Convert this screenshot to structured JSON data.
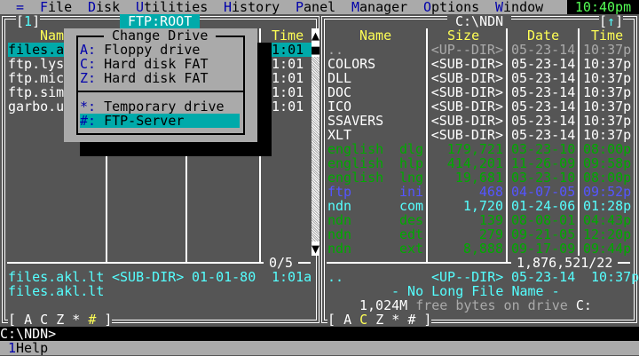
{
  "menu": {
    "items": [
      {
        "hot": "=",
        "rest": ""
      },
      {
        "hot": "F",
        "rest": "ile"
      },
      {
        "hot": "D",
        "rest": "isk"
      },
      {
        "hot": "U",
        "rest": "tilities"
      },
      {
        "hot": "H",
        "rest": "istory"
      },
      {
        "hot": "P",
        "rest": "anel"
      },
      {
        "hot": "M",
        "rest": "anager"
      },
      {
        "hot": "O",
        "rest": "ptions"
      },
      {
        "hot": "W",
        "rest": "indow"
      }
    ],
    "clock": "10:40pm"
  },
  "left": {
    "num": "1",
    "path": "FTP:ROOT",
    "headers": {
      "name": "Nam",
      "time": "Time"
    },
    "files": [
      {
        "name": "files.a",
        "time": "01:01"
      },
      {
        "name": "ftp.lys",
        "time": "01:01"
      },
      {
        "name": "ftp.mic",
        "time": "01:01"
      },
      {
        "name": "ftp.sim",
        "time": "01:01"
      },
      {
        "name": "garbo.u",
        "time": "01:01"
      }
    ],
    "counter": "0/5",
    "info": {
      "name": "files.akl.lt",
      "size": "<SUB-DIR>",
      "date": "01-01-80",
      "time": "1:01a"
    },
    "info2": "files.akl.lt",
    "drives": [
      "A",
      "C",
      "Z",
      "*",
      "#"
    ],
    "active_drive": "#"
  },
  "right": {
    "path": "C:\\NDN",
    "arrow": "↑",
    "headers": {
      "name": "Name",
      "size": "Size",
      "date": "Date",
      "time": "Time"
    },
    "files": [
      {
        "name": "..",
        "ext": "",
        "size": "<UP--DIR>",
        "date": "05-23-14",
        "time": "10:37p",
        "color": "#aaaaaa"
      },
      {
        "name": "COLORS",
        "ext": "",
        "size": "<SUB-DIR>",
        "date": "05-23-14",
        "time": "10:37p",
        "color": "#ffffff"
      },
      {
        "name": "DLL",
        "ext": "",
        "size": "<SUB-DIR>",
        "date": "05-23-14",
        "time": "10:37p",
        "color": "#ffffff"
      },
      {
        "name": "DOC",
        "ext": "",
        "size": "<SUB-DIR>",
        "date": "05-23-14",
        "time": "10:37p",
        "color": "#ffffff"
      },
      {
        "name": "ICO",
        "ext": "",
        "size": "<SUB-DIR>",
        "date": "05-23-14",
        "time": "10:37p",
        "color": "#ffffff"
      },
      {
        "name": "SSAVERS",
        "ext": "",
        "size": "<SUB-DIR>",
        "date": "05-23-14",
        "time": "10:37p",
        "color": "#ffffff"
      },
      {
        "name": "XLT",
        "ext": "",
        "size": "<SUB-DIR>",
        "date": "05-23-14",
        "time": "10:37p",
        "color": "#ffffff"
      },
      {
        "name": "english",
        "ext": "dlg",
        "size": "179,721",
        "date": "03-23-10",
        "time": "08:00p",
        "color": "#00aa00"
      },
      {
        "name": "english",
        "ext": "hlp",
        "size": "414,201",
        "date": "11-26-09",
        "time": "09:58p",
        "color": "#00aa00"
      },
      {
        "name": "english",
        "ext": "lng",
        "size": "19,681",
        "date": "03-23-10",
        "time": "08:00p",
        "color": "#00aa00"
      },
      {
        "name": "ftp",
        "ext": "ini",
        "size": "468",
        "date": "04-07-05",
        "time": "09:52p",
        "color": "#5555ff"
      },
      {
        "name": "ndn",
        "ext": "com",
        "size": "1,720",
        "date": "01-24-06",
        "time": "01:28p",
        "color": "#55ffff"
      },
      {
        "name": "ndn",
        "ext": "des",
        "size": "139",
        "date": "08-08-01",
        "time": "04:43p",
        "color": "#00aa00"
      },
      {
        "name": "ndn",
        "ext": "edt",
        "size": "279",
        "date": "09-21-05",
        "time": "12:20p",
        "color": "#00aa00"
      },
      {
        "name": "ndn",
        "ext": "ext",
        "size": "8,888",
        "date": "09-17-09",
        "time": "09:44p",
        "color": "#00aa00"
      }
    ],
    "total": "1,876,521/22",
    "info": {
      "name": "..",
      "size": "<UP--DIR>",
      "date": "05-23-14",
      "time": "10:37p"
    },
    "lfn": "- No Long File Name -",
    "free": {
      "amount": "1,024M",
      "text": "free bytes on drive",
      "drive": "C:"
    },
    "drives": [
      "A",
      "C",
      "Z",
      "*",
      "#"
    ],
    "active_drive": "C"
  },
  "dialog": {
    "title": "Change Drive",
    "items": [
      {
        "key": "A:",
        "label": "Floppy drive"
      },
      {
        "key": "C:",
        "label": "Hard disk FAT"
      },
      {
        "key": "Z:",
        "label": "Hard disk FAT"
      },
      {
        "key": "*:",
        "label": "Temporary drive"
      },
      {
        "key": "#:",
        "label": "FTP-Server"
      }
    ],
    "selected": "FTP-Server"
  },
  "cmdline": "C:\\NDN>",
  "fkeys": [
    {
      "num": "1",
      "label": "Help"
    }
  ]
}
